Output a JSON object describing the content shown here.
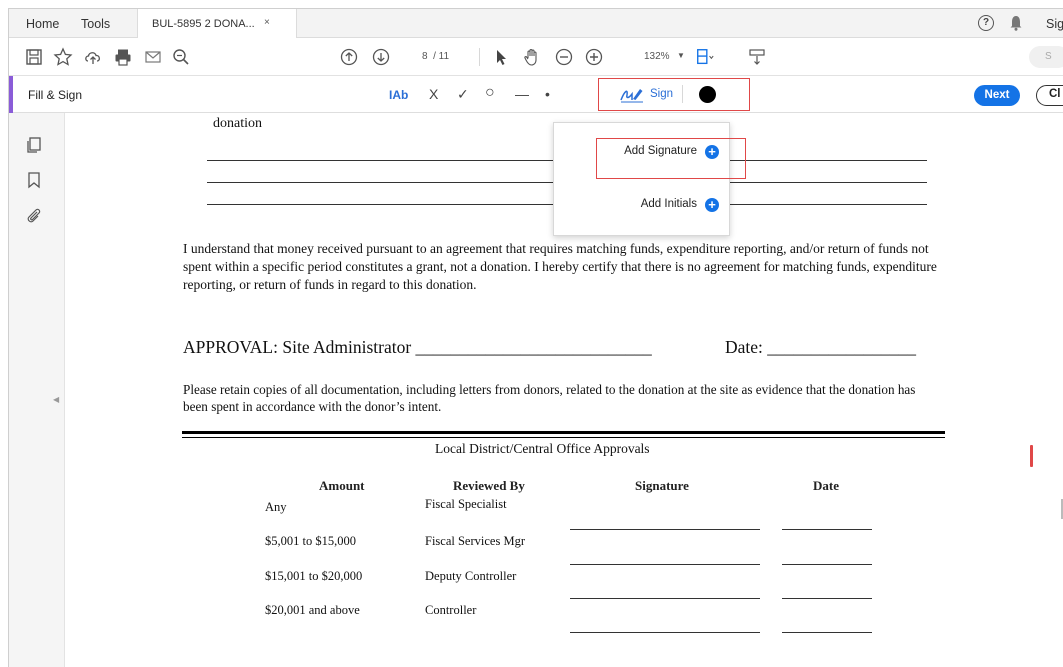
{
  "tabs": {
    "home": "Home",
    "tools": "Tools",
    "document": "BUL-5895 2 DONA...",
    "close": "×",
    "signin": "Sig"
  },
  "toolbar": {
    "page_current": "8",
    "page_total": "/ 11",
    "zoom": "132%",
    "share_label": "S"
  },
  "fillsign": {
    "title": "Fill & Sign",
    "text_tool": "Ab",
    "cross_tool": "X",
    "check_tool": "✓",
    "ellipse_tool": "○",
    "line_tool": "—",
    "dot_tool": "•",
    "sign_label": "Sign",
    "next_label": "Next",
    "close_label": "Cl",
    "ink_color": "#000000"
  },
  "dropdown": {
    "add_signature": "Add Signature",
    "add_initials": "Add Initials"
  },
  "document": {
    "donation": "donation",
    "paragraph": "I understand that money received pursuant to an agreement that requires matching funds, expenditure reporting, and/or return of funds not spent within a specific period constitutes a grant, not a donation.  I hereby certify that there is no agreement for matching funds, expenditure reporting, or return of funds in regard to this donation.",
    "approval": "APPROVAL:  Site Administrator ___________________________",
    "date": "Date: _________________",
    "retain": "Please retain copies of all documentation, including letters from donors, related to the donation at the site as evidence that the donation has been spent in accordance with the donor’s intent.",
    "local_title": "Local District/Central Office Approvals",
    "headers": [
      "Amount",
      "Reviewed By",
      "Signature",
      "Date"
    ],
    "rows": [
      {
        "amount": "Any",
        "reviewer": "Fiscal Specialist"
      },
      {
        "amount": "$5,001 to $15,000",
        "reviewer": "Fiscal Services Mgr"
      },
      {
        "amount": "$15,001 to $20,000",
        "reviewer": "Deputy Controller"
      },
      {
        "amount": "$20,001 and above",
        "reviewer": "Controller"
      }
    ]
  },
  "colors": {
    "accent": "#1473e6",
    "highlight": "#e04848",
    "fillsign_accent": "#8a5cd8"
  }
}
